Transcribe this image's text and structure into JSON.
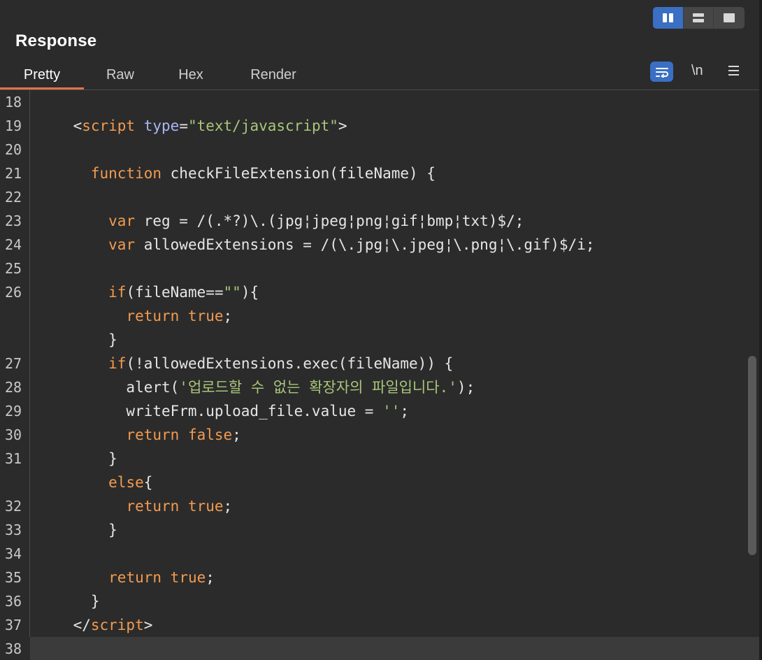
{
  "layout_toggle": {
    "buttons": [
      {
        "name": "split-view-icon",
        "active": true
      },
      {
        "name": "stacked-view-icon",
        "active": false
      },
      {
        "name": "single-view-icon",
        "active": false
      }
    ]
  },
  "panel": {
    "title": "Response"
  },
  "tabs": [
    "Pretty",
    "Raw",
    "Hex",
    "Render"
  ],
  "active_tab": "Pretty",
  "tools": {
    "wrap_icon": "word-wrap-icon",
    "newline_label": "\\n",
    "menu_icon": "hamburger-menu-icon"
  },
  "colors": {
    "accent": "#3a6fc4",
    "tab_underline": "#e2724a",
    "keyword": "#f29b50",
    "string": "#a8c67a",
    "attribute": "#a9b7f5"
  },
  "code_lines": [
    {
      "ln": "18",
      "tokens": []
    },
    {
      "ln": "19",
      "tokens": [
        [
          "p",
          "    <"
        ],
        [
          "k",
          "script"
        ],
        [
          "p",
          " "
        ],
        [
          "a",
          "type"
        ],
        [
          "p",
          "="
        ],
        [
          "s",
          "\"text/javascript\""
        ],
        [
          "p",
          ">"
        ]
      ]
    },
    {
      "ln": "20",
      "tokens": []
    },
    {
      "ln": "21",
      "tokens": [
        [
          "p",
          "      "
        ],
        [
          "k",
          "function"
        ],
        [
          "p",
          " checkFileExtension(fileName) {"
        ]
      ]
    },
    {
      "ln": "22",
      "tokens": []
    },
    {
      "ln": "23",
      "tokens": [
        [
          "p",
          "        "
        ],
        [
          "k",
          "var"
        ],
        [
          "p",
          " reg = /(.*?)\\.(jpg¦jpeg¦png¦gif¦bmp¦txt)$/;"
        ]
      ]
    },
    {
      "ln": "24",
      "tokens": [
        [
          "p",
          "        "
        ],
        [
          "k",
          "var"
        ],
        [
          "p",
          " allowedExtensions = /(\\.jpg¦\\.jpeg¦\\.png¦\\.gif)$/i;"
        ]
      ]
    },
    {
      "ln": "25",
      "tokens": []
    },
    {
      "ln": "26",
      "tokens": [
        [
          "p",
          "        "
        ],
        [
          "k",
          "if"
        ],
        [
          "p",
          "(fileName=="
        ],
        [
          "s",
          "\"\""
        ],
        [
          "p",
          "){"
        ]
      ]
    },
    {
      "ln": "",
      "tokens": [
        [
          "p",
          "          "
        ],
        [
          "k",
          "return"
        ],
        [
          "p",
          " "
        ],
        [
          "k",
          "true"
        ],
        [
          "p",
          ";"
        ]
      ]
    },
    {
      "ln": "",
      "tokens": [
        [
          "p",
          "        }"
        ]
      ]
    },
    {
      "ln": "27",
      "tokens": [
        [
          "p",
          "        "
        ],
        [
          "k",
          "if"
        ],
        [
          "p",
          "(!allowedExtensions.exec(fileName)) {"
        ]
      ]
    },
    {
      "ln": "28",
      "tokens": [
        [
          "p",
          "          alert("
        ],
        [
          "s",
          "'업로드할 수 없는 확장자의 파일입니다.'"
        ],
        [
          "p",
          ");"
        ]
      ]
    },
    {
      "ln": "29",
      "tokens": [
        [
          "p",
          "          writeFrm.upload_file.value = "
        ],
        [
          "s",
          "''"
        ],
        [
          "p",
          ";"
        ]
      ]
    },
    {
      "ln": "30",
      "tokens": [
        [
          "p",
          "          "
        ],
        [
          "k",
          "return"
        ],
        [
          "p",
          " "
        ],
        [
          "k",
          "false"
        ],
        [
          "p",
          ";"
        ]
      ]
    },
    {
      "ln": "31",
      "tokens": [
        [
          "p",
          "        }"
        ]
      ]
    },
    {
      "ln": "",
      "tokens": [
        [
          "p",
          "        "
        ],
        [
          "k",
          "else"
        ],
        [
          "p",
          "{"
        ]
      ]
    },
    {
      "ln": "32",
      "tokens": [
        [
          "p",
          "          "
        ],
        [
          "k",
          "return"
        ],
        [
          "p",
          " "
        ],
        [
          "k",
          "true"
        ],
        [
          "p",
          ";"
        ]
      ]
    },
    {
      "ln": "33",
      "tokens": [
        [
          "p",
          "        }"
        ]
      ]
    },
    {
      "ln": "34",
      "tokens": []
    },
    {
      "ln": "35",
      "tokens": [
        [
          "p",
          "        "
        ],
        [
          "k",
          "return"
        ],
        [
          "p",
          " "
        ],
        [
          "k",
          "true"
        ],
        [
          "p",
          ";"
        ]
      ]
    },
    {
      "ln": "36",
      "tokens": [
        [
          "p",
          "      }"
        ]
      ]
    },
    {
      "ln": "37",
      "tokens": [
        [
          "p",
          "    </"
        ],
        [
          "k",
          "script"
        ],
        [
          "p",
          ">"
        ]
      ]
    },
    {
      "ln": "38",
      "tokens": [],
      "current": true
    }
  ]
}
